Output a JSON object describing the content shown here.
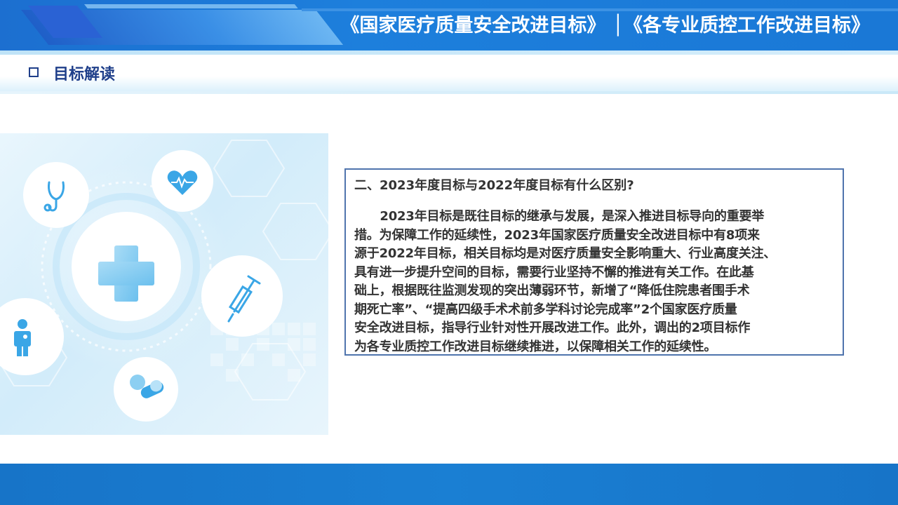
{
  "banner": {
    "title": "《国家医疗质量安全改进目标》 │《各专业质控工作改进目标》"
  },
  "section": {
    "title": "目标解读"
  },
  "content": {
    "question": "二、2023年度目标与2022年度目标有什么区别?",
    "lines": [
      "      2023年目标是既往目标的继承与发展，是深入推进目标导向的重要举",
      "措。为保障工作的延续性，2023年国家医疗质量安全改进目标中有8项来",
      "源于2022年目标，相关目标均是对医疗质量安全影响重大、行业高度关注、",
      "具有进一步提升空间的目标，需要行业坚持不懈的推进有关工作。在此基",
      "础上，根据既往监测发现的突出薄弱环节，新增了“降低住院患者围手术",
      "期死亡率”、“提高四级手术术前多学科讨论完成率”2个国家医疗质量",
      "安全改进目标，指导行业针对性开展改进工作。此外，调出的2项目标作",
      "为各专业质控工作改进目标继续推进，以保障相关工作的延续性。"
    ]
  },
  "illustration": {
    "icons": [
      "medical-cross-icon",
      "stethoscope-icon",
      "heart-rate-icon",
      "syringe-icon",
      "doctor-icon",
      "pills-icon"
    ]
  },
  "colors": {
    "banner_blue": "#1c6fd0",
    "header_text": "#1f3f8a",
    "box_border": "#4f74ad",
    "body_text": "#333333",
    "icon_blue": "#3aa6e6"
  }
}
